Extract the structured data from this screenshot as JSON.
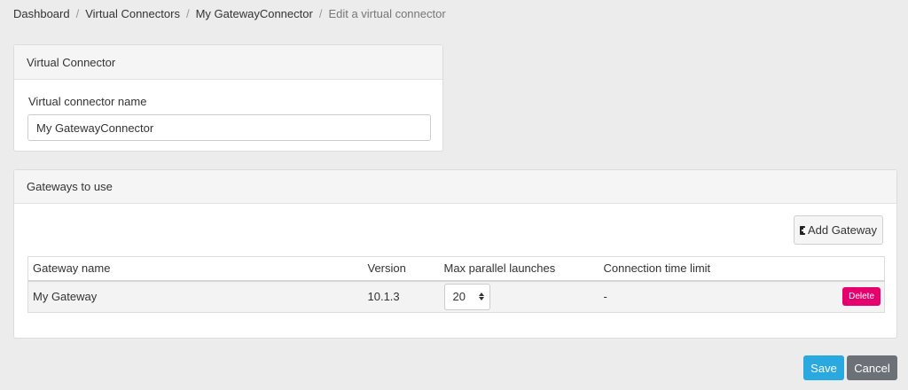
{
  "breadcrumb": {
    "items": [
      "Dashboard",
      "Virtual Connectors",
      "My GatewayConnector"
    ],
    "separator": "/",
    "current": "Edit a virtual connector"
  },
  "virtual_connector_panel": {
    "title": "Virtual Connector",
    "name_label": "Virtual connector name",
    "name_value": "My GatewayConnector"
  },
  "gateways_panel": {
    "title": "Gateways to use",
    "add_button_label": "Add Gateway",
    "table": {
      "headers": [
        "Gateway name",
        "Version",
        "Max parallel launches",
        "Connection time limit"
      ],
      "rows": [
        {
          "name": "My Gateway",
          "version": "10.1.3",
          "max_parallel_launches": "20",
          "connection_time_limit": "-",
          "delete_label": "Delete"
        }
      ]
    }
  },
  "actions": {
    "save_label": "Save",
    "cancel_label": "Cancel"
  },
  "colors": {
    "background": "#ececec",
    "save": "#2aa8e0",
    "cancel": "#6c7177",
    "delete": "#e6006e"
  },
  "icons": {
    "add": "plus-square-icon",
    "spinner": "spinner-arrows-icon"
  }
}
